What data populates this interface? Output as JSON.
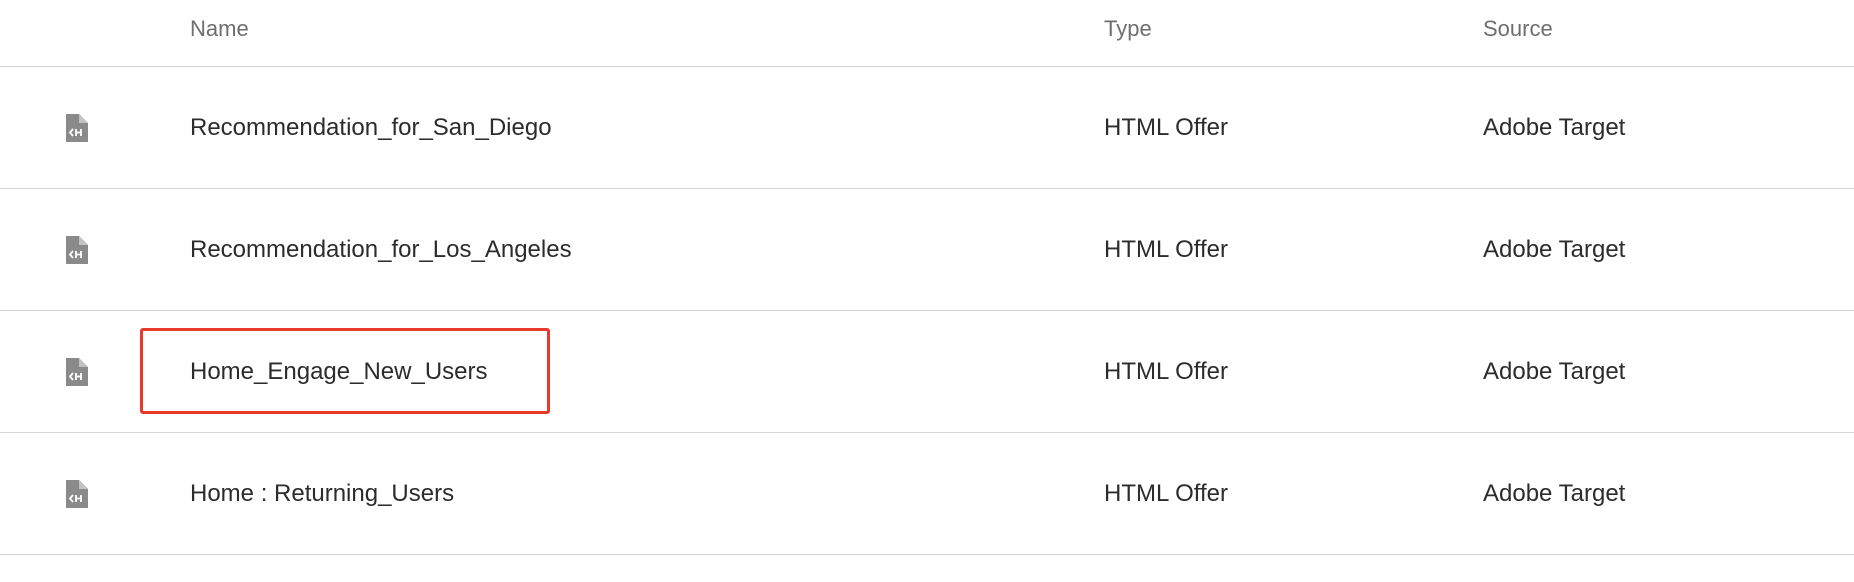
{
  "table": {
    "headers": {
      "name": "Name",
      "type": "Type",
      "source": "Source"
    },
    "rows": [
      {
        "icon": "html-offer-file-icon",
        "name": "Recommendation_for_San_Diego",
        "type": "HTML Offer",
        "source": "Adobe Target"
      },
      {
        "icon": "html-offer-file-icon",
        "name": "Recommendation_for_Los_Angeles",
        "type": "HTML Offer",
        "source": "Adobe Target"
      },
      {
        "icon": "html-offer-file-icon",
        "name": "Home_Engage_New_Users",
        "type": "HTML Offer",
        "source": "Adobe Target"
      },
      {
        "icon": "html-offer-file-icon",
        "name": "Home : Returning_Users",
        "type": "HTML Offer",
        "source": "Adobe Target"
      }
    ]
  },
  "highlight": {
    "color": "#e8392b",
    "target_row": "Home_Engage_New_Users"
  }
}
